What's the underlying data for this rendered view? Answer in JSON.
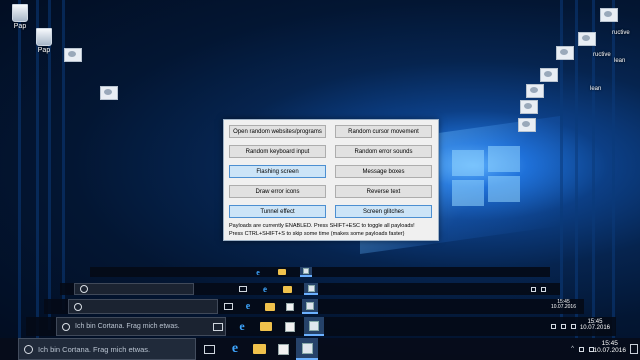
{
  "desktop": {
    "icons": [
      {
        "label": "Pap",
        "icon": "recycle-bin-icon"
      },
      {
        "label": "Pap",
        "icon": "recycle-bin-icon"
      }
    ],
    "glitch_labels": [
      "ructive",
      "ructive",
      "lean",
      "lean"
    ]
  },
  "payload_window": {
    "buttons": [
      {
        "label": "Open random websites/programs",
        "enabled": false
      },
      {
        "label": "Random cursor movement",
        "enabled": false
      },
      {
        "label": "Random keyboard input",
        "enabled": false
      },
      {
        "label": "Random error sounds",
        "enabled": false
      },
      {
        "label": "Flashing screen",
        "enabled": true
      },
      {
        "label": "Message boxes",
        "enabled": false
      },
      {
        "label": "Draw error icons",
        "enabled": false
      },
      {
        "label": "Reverse text",
        "enabled": false
      },
      {
        "label": "Tunnel effect",
        "enabled": true
      },
      {
        "label": "Screen glitches",
        "enabled": true
      }
    ],
    "info_line1": "Payloads are currently ENABLED. Press SHIFT+ESC to toggle all payloads!",
    "info_line2": "Press CTRL+SHIFT+S to skip some time (makes some payloads faster)"
  },
  "taskbar": {
    "search_placeholder": "Ich bin Cortana. Frag mich etwas.",
    "time": "15:45",
    "date": "10.07.2016",
    "icons": [
      "task-view-icon",
      "edge-icon",
      "file-explorer-icon",
      "store-icon",
      "memz-app-icon"
    ]
  },
  "colors": {
    "button_enabled_bg": "#cce4f7",
    "button_enabled_border": "#4c8fd1",
    "window_bg": "#f0f0f0"
  }
}
